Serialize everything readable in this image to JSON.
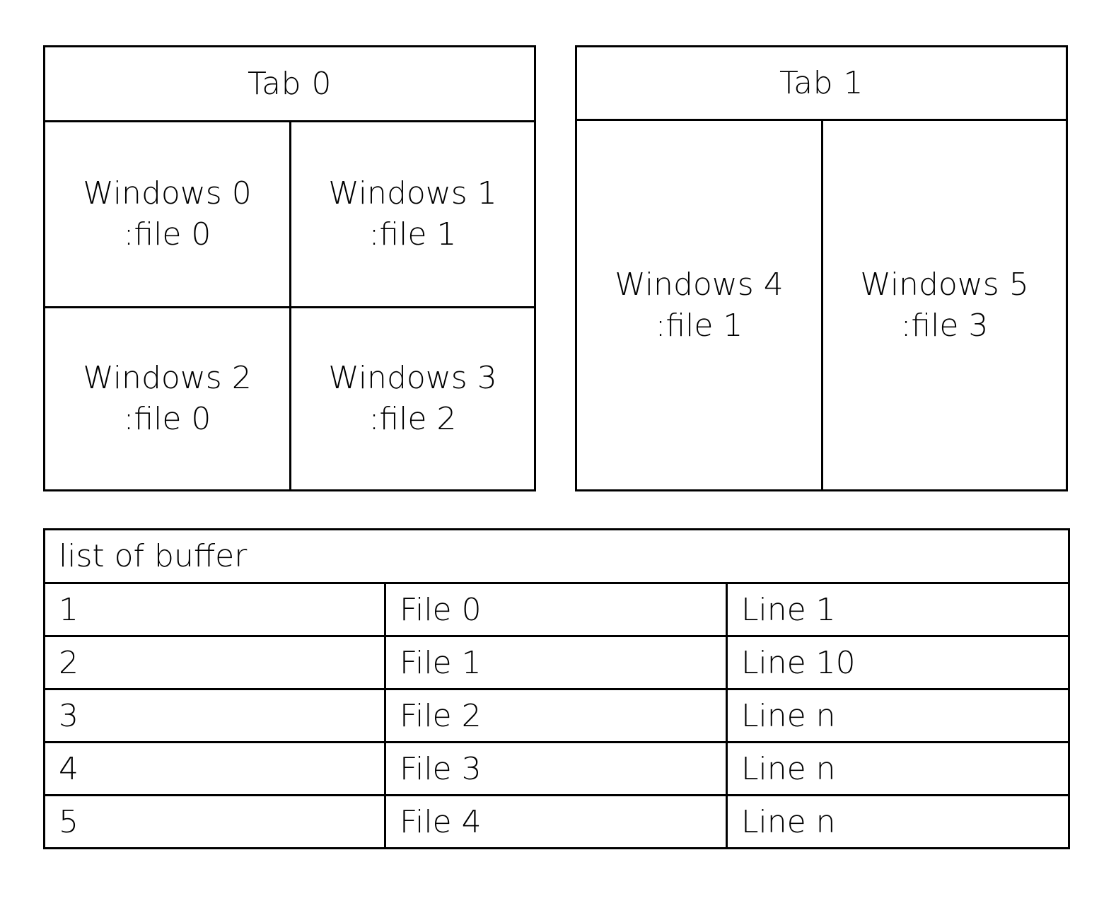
{
  "tabs": [
    {
      "title": "Tab 0",
      "windows": [
        {
          "name": "Windows 0",
          "file": ":file 0"
        },
        {
          "name": "Windows 1",
          "file": ":file 1"
        },
        {
          "name": "Windows 2",
          "file": ":file 0"
        },
        {
          "name": "Windows 3",
          "file": ":file 2"
        }
      ]
    },
    {
      "title": "Tab 1",
      "windows": [
        {
          "name": "Windows 4",
          "file": ":file 1"
        },
        {
          "name": "Windows 5",
          "file": ":file 3"
        }
      ]
    }
  ],
  "buffer_list": {
    "title": "list of buffer",
    "rows": [
      {
        "number": "1",
        "file": "File 0",
        "line": "Line 1"
      },
      {
        "number": "2",
        "file": "File 1",
        "line": "Line 10"
      },
      {
        "number": "3",
        "file": "File 2",
        "line": "Line n"
      },
      {
        "number": "4",
        "file": "File 3",
        "line": "Line n"
      },
      {
        "number": "5",
        "file": "File 4",
        "line": "Line n"
      }
    ]
  }
}
